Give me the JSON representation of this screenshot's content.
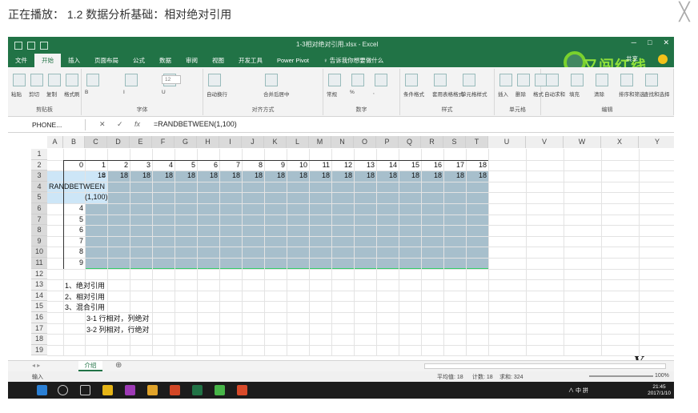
{
  "player": {
    "title": "正在播放： 1.2 数据分析基础：相对绝对引用",
    "close_label": "╳"
  },
  "excel": {
    "file_title": "1-3相对绝对引用.xlsx - Excel",
    "tabs": [
      "文件",
      "开始",
      "插入",
      "页面布局",
      "公式",
      "数据",
      "审阅",
      "视图",
      "开发工具",
      "Power Pivot",
      "♀ 告诉我你想要做什么"
    ],
    "active_tab": "开始",
    "share_label": "共享",
    "brand_text": "又闯红线",
    "ribbon_groups": [
      {
        "name": "剪贴板",
        "buttons": [
          "粘贴",
          "剪切",
          "复制",
          "格式刷"
        ]
      },
      {
        "name": "字体",
        "buttons": [
          "B",
          "I",
          "U"
        ]
      },
      {
        "name": "对齐方式",
        "buttons": [
          "自动换行",
          "合并后居中"
        ]
      },
      {
        "name": "数字",
        "buttons": [
          "常规",
          "%",
          ","
        ]
      },
      {
        "name": "样式",
        "buttons": [
          "条件格式",
          "套用表格格式",
          "单元格样式"
        ]
      },
      {
        "name": "单元格",
        "buttons": [
          "插入",
          "删除",
          "格式"
        ]
      },
      {
        "name": "编辑",
        "buttons": [
          "自动求和",
          "填充",
          "清除",
          "排序和筛选",
          "查找和选择"
        ]
      }
    ],
    "font_size": "12",
    "name_box": "PHONE...",
    "formula_bar_buttons": {
      "cancel": "✕",
      "enter": "✓",
      "fx": "fx"
    },
    "formula": "=RANDBETWEEN(1,100)",
    "columns": [
      "A",
      "B",
      "C",
      "D",
      "E",
      "F",
      "G",
      "H",
      "I",
      "J",
      "K",
      "L",
      "M",
      "N",
      "O",
      "P",
      "Q",
      "R",
      "S",
      "T",
      "U",
      "V",
      "W",
      "X",
      "Y"
    ],
    "rows": [
      "1",
      "2",
      "3",
      "4",
      "5",
      "6",
      "7",
      "8",
      "9",
      "10",
      "11",
      "12",
      "13",
      "14",
      "15",
      "16",
      "17",
      "18",
      "19"
    ],
    "row2_values": [
      "0",
      "1",
      "2",
      "3",
      "4",
      "5",
      "6",
      "7",
      "8",
      "9",
      "10",
      "11",
      "12",
      "13",
      "14",
      "15",
      "16",
      "17",
      "18"
    ],
    "row3_values": [
      "=",
      "18",
      "18",
      "18",
      "18",
      "18",
      "18",
      "18",
      "18",
      "18",
      "18",
      "18",
      "18",
      "18",
      "18",
      "18",
      "18",
      "18",
      "18"
    ],
    "b_column_values": [
      "4",
      "5",
      "6",
      "7",
      "8",
      "9"
    ],
    "edit_cell_lines": [
      "RANDBETWEEN",
      "(1,100)"
    ],
    "notes": [
      "1、绝对引用",
      "2、相对引用",
      "3、混合引用",
      "3-1 行相对，列绝对",
      "3-2 列相对，行绝对"
    ],
    "sheet_tab": "介绍",
    "add_sheet": "⊕",
    "status": {
      "mode": "输入",
      "average": "平均值: 18",
      "count": "计数: 18",
      "sum": "求和: 324",
      "zoom": "100%"
    },
    "logo_mark": "V",
    "clock": {
      "time": "21:45",
      "date": "2017/1/10"
    },
    "tray_text": "∧ 中 拼"
  },
  "colors": {
    "excel_green": "#217346",
    "selection": "#a7bfcc",
    "active_cell": "#cde6f7"
  }
}
